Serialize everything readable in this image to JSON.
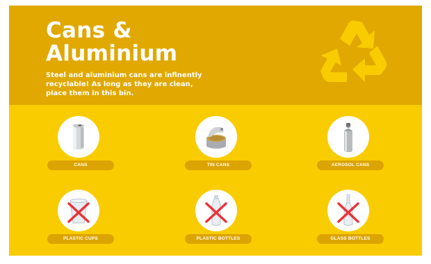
{
  "sign": {
    "title_line1": "Cans &",
    "title_line2": "Aluminium",
    "description": "Steel and aluminium cans are infinently recyclable! As long as they are clean, place them in this bin.",
    "icon": "recycle-icon",
    "colors": {
      "header": "#e0a800",
      "body": "#f9cc00",
      "pill": "#dca400",
      "recycle_symbol": "#f9cc00",
      "cross": "#e8343c"
    }
  },
  "accepted_items": [
    {
      "label": "CANS",
      "icon": "drink-can-icon"
    },
    {
      "label": "TIN CANS",
      "icon": "tin-can-icon"
    },
    {
      "label": "AEROSOL CANS",
      "icon": "aerosol-can-icon"
    }
  ],
  "rejected_items": [
    {
      "label": "PLASTIC CUPS",
      "icon": "plastic-cup-icon"
    },
    {
      "label": "PLASTIC BOTTLES",
      "icon": "plastic-bottle-icon"
    },
    {
      "label": "GLASS BOTTLES",
      "icon": "glass-bottle-icon"
    }
  ]
}
